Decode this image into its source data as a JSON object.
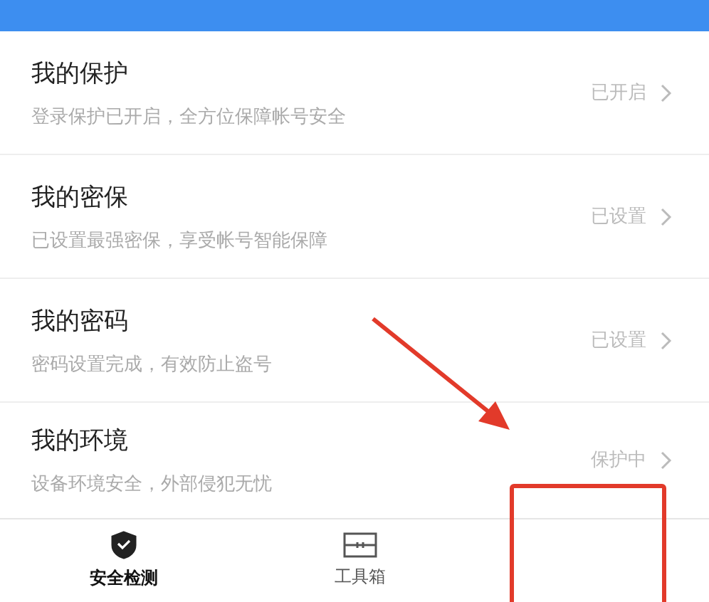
{
  "items": [
    {
      "title": "我的保护",
      "subtitle": "登录保护已开启，全方位保障帐号安全",
      "status": "已开启"
    },
    {
      "title": "我的密保",
      "subtitle": "已设置最强密保，享受帐号智能保障",
      "status": "已设置"
    },
    {
      "title": "我的密码",
      "subtitle": "密码设置完成，有效防止盗号",
      "status": "已设置"
    },
    {
      "title": "我的环境",
      "subtitle": "设备环境安全，外部侵犯无忧",
      "status": "保护中"
    }
  ],
  "tabs": [
    {
      "label": "安全检测",
      "kind": "shield",
      "selected": true
    },
    {
      "label": "工具箱",
      "kind": "toolbox",
      "selected": false
    }
  ]
}
